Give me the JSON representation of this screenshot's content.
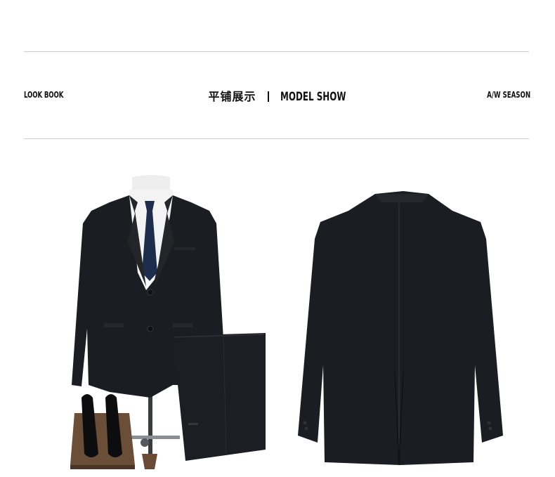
{
  "header": {
    "left_label": "LOOK BOOK",
    "center_title_cn": "平铺展示",
    "center_title_en": "MODEL SHOW",
    "right_label": "A/W SEASON"
  },
  "colors": {
    "suit": "#1b1d22",
    "tie": "#1f2d4d",
    "shirt": "#f3f3f3",
    "rule": "#cfcfcf",
    "wood_box": "#6b4e37"
  },
  "icons": {
    "front_view": "suit-front-image",
    "back_view": "suit-back-image"
  }
}
